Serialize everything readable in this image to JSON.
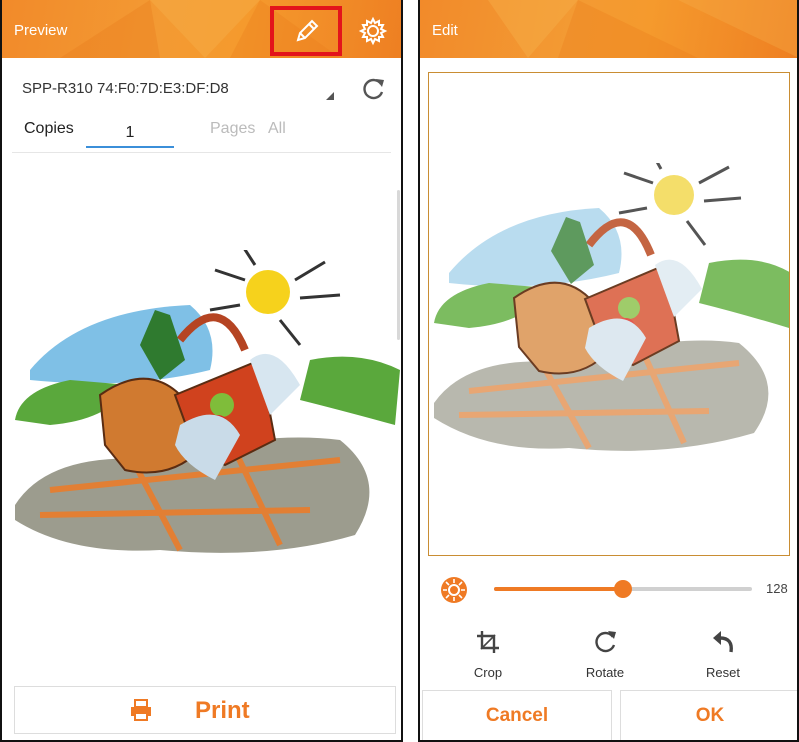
{
  "left_screen": {
    "title": "Preview",
    "printer": "SPP-R310 74:F0:7D:E3:DF:D8",
    "copies_label": "Copies",
    "copies_value": "1",
    "pages_label": "Pages",
    "pages_value": "All",
    "print_label": "Print",
    "icons": [
      "pencil-icon",
      "gear-icon",
      "refresh-icon",
      "printer-icon"
    ],
    "highlight_color": "#e3141b"
  },
  "right_screen": {
    "title": "Edit",
    "brightness_value": "128",
    "brightness_level": 0.5,
    "tools": [
      {
        "label": "Crop",
        "icon": "crop-icon"
      },
      {
        "label": "Rotate",
        "icon": "rotate-icon"
      },
      {
        "label": "Reset",
        "icon": "undo-icon"
      }
    ],
    "cancel_label": "Cancel",
    "ok_label": "OK"
  },
  "colors": {
    "accent": "#ef7a24",
    "appbar": "#f39a33",
    "highlight": "#e3141b"
  }
}
